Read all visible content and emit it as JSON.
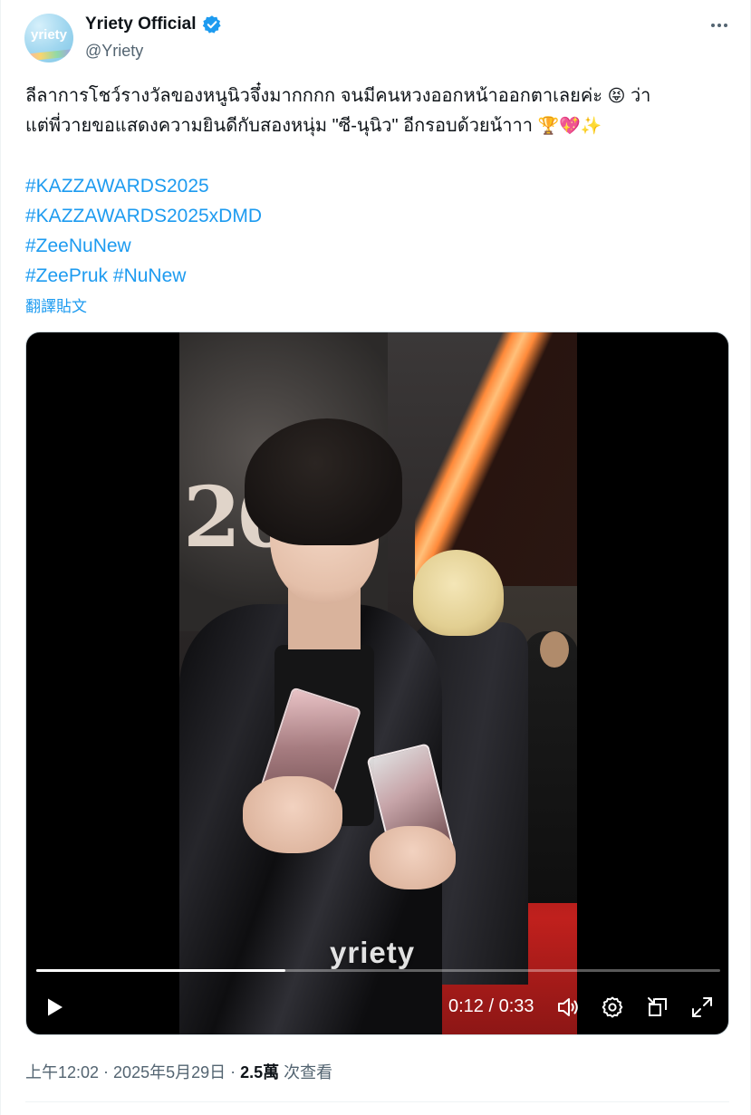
{
  "author": {
    "display_name": "Yriety Official",
    "handle": "@Yriety",
    "avatar_text": "yriety",
    "verified": true
  },
  "tweet": {
    "line1": "ลีลาการโชว์รางวัลของหนูนิวจึ๋งมากกกก จนมีคนหวงออกหน้าออกตาเลยค่ะ",
    "line1_emoji": "😝",
    "line1_tail": "ว่า",
    "line2": "แต่พี่วายขอแสดงความยินดีกับสองหนุ่ม \"ซี-นุนิว\" อีกรอบด้วยน้าาา",
    "line2_emojis": "🏆💖✨",
    "hashtags": [
      "#KAZZAWARDS2025",
      "#KAZZAWARDS2025xDMD",
      "#ZeeNuNew"
    ],
    "hashtag_last_a": "#ZeePruk",
    "hashtag_last_b": "#NuNew",
    "translate_label": "翻譯貼文"
  },
  "video": {
    "watermark": "yriety",
    "current_time": "0:12",
    "separator": "/",
    "duration": "0:33",
    "progress_fraction": 0.364,
    "icons": [
      "play-icon",
      "volume-icon",
      "settings-icon",
      "picture-in-picture-icon",
      "fullscreen-icon"
    ]
  },
  "meta": {
    "time": "上午12:02",
    "dot1": "·",
    "date": "2025年5月29日",
    "dot2": "·",
    "views_count": "2.5萬",
    "views_label": "次查看"
  },
  "colors": {
    "link": "#1d9bf0",
    "verified": "#1d9bf0",
    "secondary_text": "#536471"
  }
}
